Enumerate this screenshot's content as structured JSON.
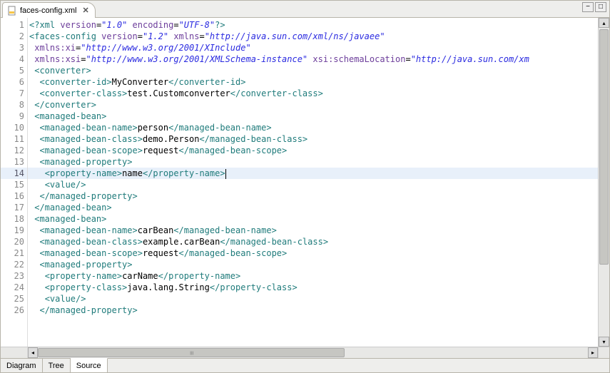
{
  "tab": {
    "filename": "faces-config.xml",
    "close_glyph": "✕"
  },
  "window_controls": {
    "minimize": "−",
    "maximize": "□"
  },
  "scroll": {
    "up": "▴",
    "down": "▾",
    "left": "◂",
    "right": "▸"
  },
  "lines": [
    {
      "n": 1,
      "fold": false,
      "cur": false,
      "html": "<span class=t-pi>&lt;?xml</span> <span class=t-attr>version</span>=<span class=t-str>\"1.0\"</span> <span class=t-attr>encoding</span>=<span class=t-str>\"UTF-8\"</span><span class=t-pi>?&gt;</span>"
    },
    {
      "n": 2,
      "fold": true,
      "cur": false,
      "html": "<span class=t-tag>&lt;faces-config</span> <span class=t-attr>version</span>=<span class=t-str>\"1.2\"</span> <span class=t-attr>xmlns</span>=<span class=t-str>\"http://java.sun.com/xml/ns/javaee\"</span>"
    },
    {
      "n": 3,
      "fold": false,
      "cur": false,
      "html": " <span class=t-attr>xmlns:xi</span>=<span class=t-str>\"http://www.w3.org/2001/XInclude\"</span>"
    },
    {
      "n": 4,
      "fold": false,
      "cur": false,
      "html": " <span class=t-attr>xmlns:xsi</span>=<span class=t-str>\"http://www.w3.org/2001/XMLSchema-instance\"</span> <span class=t-attr>xsi:schemaLocation</span>=<span class=t-str>\"http://java.sun.com/xm</span>"
    },
    {
      "n": 5,
      "fold": true,
      "cur": false,
      "html": " <span class=t-tag>&lt;converter&gt;</span>"
    },
    {
      "n": 6,
      "fold": false,
      "cur": false,
      "html": "  <span class=t-tag>&lt;converter-id&gt;</span><span class=t-text>MyConverter</span><span class=t-tag>&lt;/converter-id&gt;</span>"
    },
    {
      "n": 7,
      "fold": false,
      "cur": false,
      "html": "  <span class=t-tag>&lt;converter-class&gt;</span><span class=t-text>test.Customconverter</span><span class=t-tag>&lt;/converter-class&gt;</span>"
    },
    {
      "n": 8,
      "fold": false,
      "cur": false,
      "html": " <span class=t-tag>&lt;/converter&gt;</span>"
    },
    {
      "n": 9,
      "fold": true,
      "cur": false,
      "html": " <span class=t-tag>&lt;managed-bean&gt;</span>"
    },
    {
      "n": 10,
      "fold": false,
      "cur": false,
      "html": "  <span class=t-tag>&lt;managed-bean-name&gt;</span><span class=t-text>person</span><span class=t-tag>&lt;/managed-bean-name&gt;</span>"
    },
    {
      "n": 11,
      "fold": false,
      "cur": false,
      "html": "  <span class=t-tag>&lt;managed-bean-class&gt;</span><span class=t-text>demo.Person</span><span class=t-tag>&lt;/managed-bean-class&gt;</span>"
    },
    {
      "n": 12,
      "fold": false,
      "cur": false,
      "html": "  <span class=t-tag>&lt;managed-bean-scope&gt;</span><span class=t-text>request</span><span class=t-tag>&lt;/managed-bean-scope&gt;</span>"
    },
    {
      "n": 13,
      "fold": true,
      "cur": false,
      "html": "  <span class=t-tag>&lt;managed-property&gt;</span>"
    },
    {
      "n": 14,
      "fold": false,
      "cur": true,
      "html": "   <span class=t-tag>&lt;property-name&gt;</span><span class=t-text>name</span><span class=t-tag>&lt;/property-name&gt;</span><span class=caret></span>"
    },
    {
      "n": 15,
      "fold": false,
      "cur": false,
      "html": "   <span class=t-tag>&lt;value/&gt;</span>"
    },
    {
      "n": 16,
      "fold": false,
      "cur": false,
      "html": "  <span class=t-tag>&lt;/managed-property&gt;</span>"
    },
    {
      "n": 17,
      "fold": false,
      "cur": false,
      "html": " <span class=t-tag>&lt;/managed-bean&gt;</span>"
    },
    {
      "n": 18,
      "fold": true,
      "cur": false,
      "html": " <span class=t-tag>&lt;managed-bean&gt;</span>"
    },
    {
      "n": 19,
      "fold": false,
      "cur": false,
      "html": "  <span class=t-tag>&lt;managed-bean-name&gt;</span><span class=t-text>carBean</span><span class=t-tag>&lt;/managed-bean-name&gt;</span>"
    },
    {
      "n": 20,
      "fold": false,
      "cur": false,
      "html": "  <span class=t-tag>&lt;managed-bean-class&gt;</span><span class=t-text>example.carBean</span><span class=t-tag>&lt;/managed-bean-class&gt;</span>"
    },
    {
      "n": 21,
      "fold": false,
      "cur": false,
      "html": "  <span class=t-tag>&lt;managed-bean-scope&gt;</span><span class=t-text>request</span><span class=t-tag>&lt;/managed-bean-scope&gt;</span>"
    },
    {
      "n": 22,
      "fold": true,
      "cur": false,
      "html": "  <span class=t-tag>&lt;managed-property&gt;</span>"
    },
    {
      "n": 23,
      "fold": false,
      "cur": false,
      "html": "   <span class=t-tag>&lt;property-name&gt;</span><span class=t-text>carName</span><span class=t-tag>&lt;/property-name&gt;</span>"
    },
    {
      "n": 24,
      "fold": false,
      "cur": false,
      "html": "   <span class=t-tag>&lt;property-class&gt;</span><span class=t-text>java.lang.String</span><span class=t-tag>&lt;/property-class&gt;</span>"
    },
    {
      "n": 25,
      "fold": false,
      "cur": false,
      "html": "   <span class=t-tag>&lt;value/&gt;</span>"
    },
    {
      "n": 26,
      "fold": false,
      "cur": false,
      "html": "  <span class=t-tag>&lt;/managed-property&gt;</span>"
    }
  ],
  "bottom_tabs": {
    "diagram": "Diagram",
    "tree": "Tree",
    "source": "Source"
  }
}
